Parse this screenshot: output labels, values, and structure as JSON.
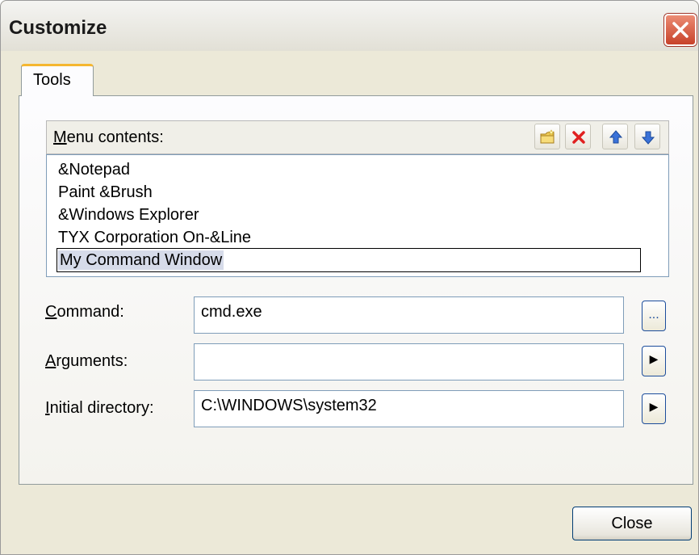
{
  "window": {
    "title": "Customize"
  },
  "tabs": [
    {
      "label": "Tools",
      "active": true
    }
  ],
  "menu_contents": {
    "label_mnemonic": "M",
    "label_rest": "enu contents:",
    "items": [
      "&Notepad",
      "Paint &Brush",
      "&Windows Explorer",
      "TYX Corporation On-&Line",
      "My Command Window"
    ],
    "selected_index": 4,
    "toolbar_icons": [
      "new-folder-icon",
      "delete-icon",
      "move-up-icon",
      "move-down-icon"
    ]
  },
  "fields": {
    "command": {
      "label_mnemonic": "C",
      "label_rest": "ommand:",
      "value": "cmd.exe",
      "button": "..."
    },
    "arguments": {
      "label_mnemonic": "A",
      "label_rest": "rguments:",
      "value": "",
      "button": "▶"
    },
    "initial_directory": {
      "label_mnemonic": "I",
      "label_rest": "nitial directory:",
      "value": "C:\\WINDOWS\\system32",
      "button": "▶"
    }
  },
  "buttons": {
    "close": "Close"
  },
  "colors": {
    "accent_tab": "#f5b730",
    "close_red": "#c8422a",
    "selection": "#d6dbe9",
    "arrow_blue": "#3a72d8"
  }
}
